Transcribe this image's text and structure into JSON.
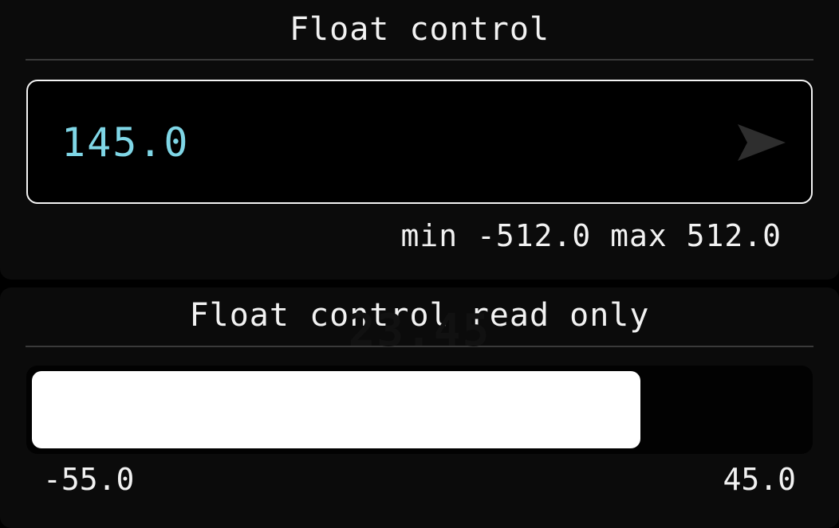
{
  "float_control": {
    "title": "Float control",
    "value": "145.0",
    "range_label": "min -512.0 max 512.0",
    "value_color": "#7fd6e6",
    "send_icon": "send-arrow-icon"
  },
  "float_control_read_only": {
    "title": "Float control read only",
    "value": "23.45",
    "min_label": "-55.0",
    "max_label": "45.0",
    "fill_fraction": 0.785
  }
}
